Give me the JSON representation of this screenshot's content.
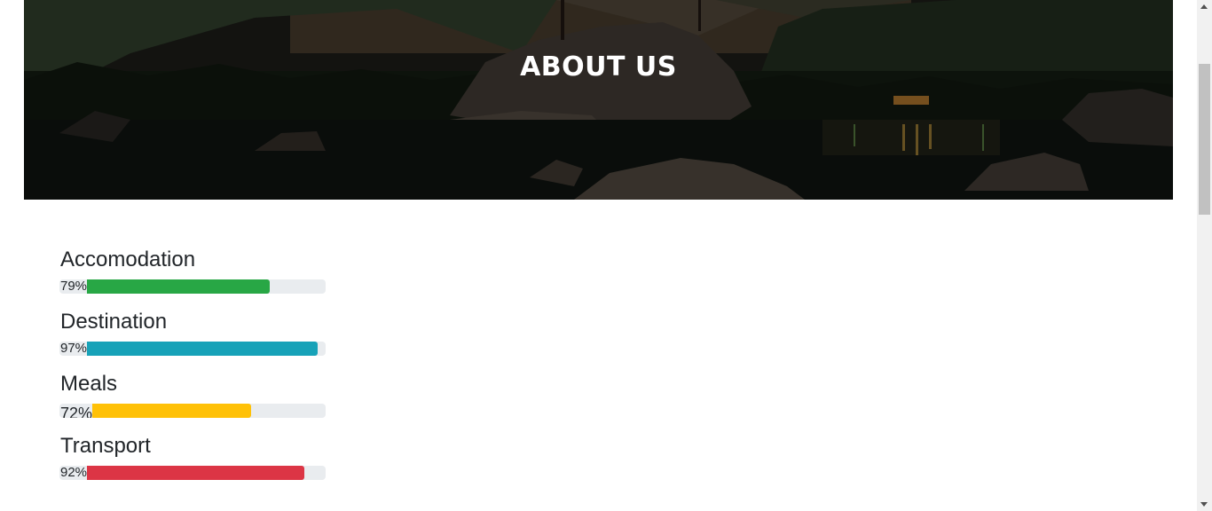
{
  "hero": {
    "title": "ABOUT US"
  },
  "skills": [
    {
      "label": "Accomodation",
      "percent_text": "79%",
      "percent": 79,
      "color": "#28a745"
    },
    {
      "label": "Destination",
      "percent_text": "97%",
      "percent": 97,
      "color": "#17a2b8"
    },
    {
      "label": "Meals",
      "percent_text": "72%",
      "percent": 72,
      "color": "#ffc107"
    },
    {
      "label": "Transport",
      "percent_text": "92%",
      "percent": 92,
      "color": "#dc3545"
    }
  ]
}
